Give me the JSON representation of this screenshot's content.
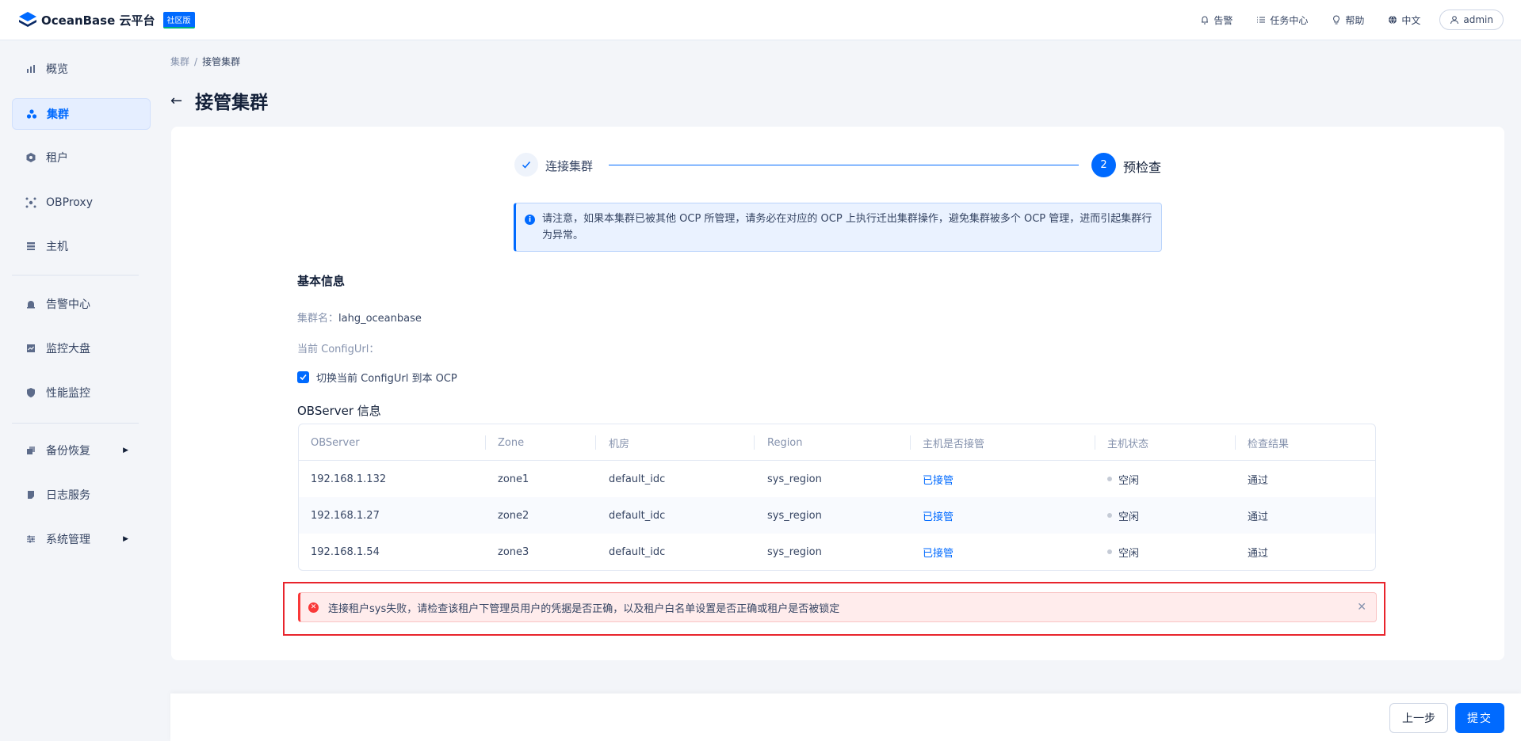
{
  "header": {
    "logo_text": "OceanBase 云平台",
    "badge": "社区版",
    "items": [
      {
        "label": "告警",
        "icon": "bell-icon"
      },
      {
        "label": "任务中心",
        "icon": "list-icon"
      },
      {
        "label": "帮助",
        "icon": "bulb-icon"
      },
      {
        "label": "中文",
        "icon": "globe-icon"
      }
    ],
    "user": "admin"
  },
  "sidebar": {
    "items": [
      {
        "label": "概览",
        "icon": "bar-chart-icon"
      },
      {
        "label": "集群",
        "icon": "cluster-icon",
        "active": true
      },
      {
        "label": "租户",
        "icon": "tenant-icon"
      },
      {
        "label": "OBProxy",
        "icon": "proxy-icon"
      },
      {
        "label": "主机",
        "icon": "host-icon"
      },
      {
        "label": "告警中心",
        "icon": "alarm-icon"
      },
      {
        "label": "监控大盘",
        "icon": "monitor-icon"
      },
      {
        "label": "性能监控",
        "icon": "performance-icon"
      },
      {
        "label": "备份恢复",
        "icon": "backup-icon",
        "expandable": true
      },
      {
        "label": "日志服务",
        "icon": "log-icon"
      },
      {
        "label": "系统管理",
        "icon": "settings-icon",
        "expandable": true
      }
    ]
  },
  "breadcrumb": {
    "parent": "集群",
    "separator": "/",
    "current": "接管集群"
  },
  "page_title": "接管集群",
  "steps": [
    {
      "number": "",
      "label": "连接集群",
      "status": "done"
    },
    {
      "number": "2",
      "label": "预检查",
      "status": "current"
    }
  ],
  "info_alert": "请注意，如果本集群已被其他 OCP 所管理，请务必在对应的 OCP 上执行迁出集群操作，避免集群被多个 OCP 管理，进而引起集群行为异常。",
  "basic_info": {
    "title": "基本信息",
    "cluster_name_label": "集群名：",
    "cluster_name": "lahg_oceanbase",
    "config_url_label": "当前 ConfigUrl："
  },
  "checkbox_label": "切换当前 ConfigUrl 到本 OCP",
  "obs_title": "OBServer 信息",
  "table": {
    "columns": [
      "OBServer",
      "Zone",
      "机房",
      "Region",
      "主机是否接管",
      "主机状态",
      "检查结果"
    ],
    "rows": [
      [
        "192.168.1.132",
        "zone1",
        "default_idc",
        "sys_region",
        "已接管",
        "空闲",
        "通过"
      ],
      [
        "192.168.1.27",
        "zone2",
        "default_idc",
        "sys_region",
        "已接管",
        "空闲",
        "通过"
      ],
      [
        "192.168.1.54",
        "zone3",
        "default_idc",
        "sys_region",
        "已接管",
        "空闲",
        "通过"
      ]
    ]
  },
  "error_alert": "连接租户sys失败，请检查该租户下管理员用户的凭据是否正确，以及租户白名单设置是否正确或租户是否被锁定",
  "footer": {
    "prev": "上一步",
    "submit": "提交"
  },
  "colors": {
    "primary": "#006aff",
    "error": "#f93939",
    "highlight": "#e8242c"
  }
}
